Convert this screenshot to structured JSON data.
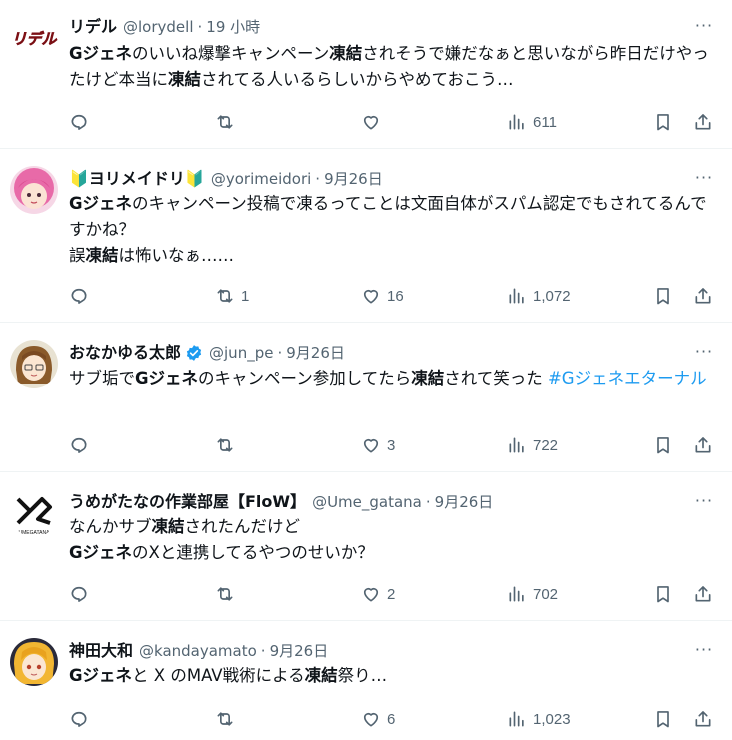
{
  "tweets": [
    {
      "display_name": "リデル",
      "handle": "@lorydell",
      "time": "19 小時",
      "body_parts": [
        {
          "t": "Gジェネ",
          "b": true
        },
        {
          "t": "のいいね爆撃キャンペーン"
        },
        {
          "t": "凍結",
          "b": true
        },
        {
          "t": "されそうで嫌だなぁと思いながら昨日だけやったけど本当に"
        },
        {
          "t": "凍結",
          "b": true
        },
        {
          "t": "されてる人いるらしいからやめておこう…"
        }
      ],
      "replies": "",
      "reposts": "",
      "likes": "",
      "views": "611",
      "avatar_text": "リデル"
    },
    {
      "display_name": "🔰ヨリメイドリ🔰",
      "handle": "@yorimeidori",
      "time": "9月26日",
      "body_parts": [
        {
          "t": "Gジェネ",
          "b": true
        },
        {
          "t": "のキャンペーン投稿で凍るってことは文面自体がスパム認定でもされてるんですかね？\n誤"
        },
        {
          "t": "凍結",
          "b": true
        },
        {
          "t": "は怖いなぁ……"
        }
      ],
      "replies": "",
      "reposts": "1",
      "likes": "16",
      "views": "1,072"
    },
    {
      "display_name": "おなかゆる太郎",
      "handle": "@jun_pe",
      "time": "9月26日",
      "verified": true,
      "body_parts": [
        {
          "t": "サブ垢で"
        },
        {
          "t": "Gジェネ",
          "b": true
        },
        {
          "t": "のキャンペーン参加してたら"
        },
        {
          "t": "凍結",
          "b": true
        },
        {
          "t": "されて笑った "
        },
        {
          "t": "#Gジェネエターナル",
          "h": true
        }
      ],
      "replies": "",
      "reposts": "",
      "likes": "3",
      "views": "722"
    },
    {
      "display_name": "うめがたなの作業部屋【FloW】",
      "handle": "@Ume_gatana",
      "time": "9月26日",
      "body_parts": [
        {
          "t": "なんかサブ"
        },
        {
          "t": "凍結",
          "b": true
        },
        {
          "t": "されたんだけど\n"
        },
        {
          "t": "Gジェネ",
          "b": true
        },
        {
          "t": "のXと連携してるやつのせいか？"
        }
      ],
      "replies": "",
      "reposts": "",
      "likes": "2",
      "views": "702",
      "avatar_text": "UMEGATANA"
    },
    {
      "display_name": "神田大和",
      "handle": "@kandayamato",
      "time": "9月26日",
      "body_parts": [
        {
          "t": "Gジェネ",
          "b": true
        },
        {
          "t": "と X のMAV戦術による"
        },
        {
          "t": "凍結",
          "b": true
        },
        {
          "t": "祭り…"
        }
      ],
      "replies": "",
      "reposts": "",
      "likes": "6",
      "views": "1,023"
    }
  ],
  "dot": "·",
  "more_label": "···",
  "icons": {
    "reply": "reply-icon",
    "repost": "repost-icon",
    "like": "heart-icon",
    "views": "views-icon",
    "bookmark": "bookmark-icon",
    "share": "share-icon",
    "verified": "verified-badge-icon"
  },
  "colors": {
    "text": "#0f1419",
    "secondary": "#536471",
    "link": "#1d9bf0",
    "verified": "#1d9bf0",
    "divider": "#eff3f4"
  }
}
